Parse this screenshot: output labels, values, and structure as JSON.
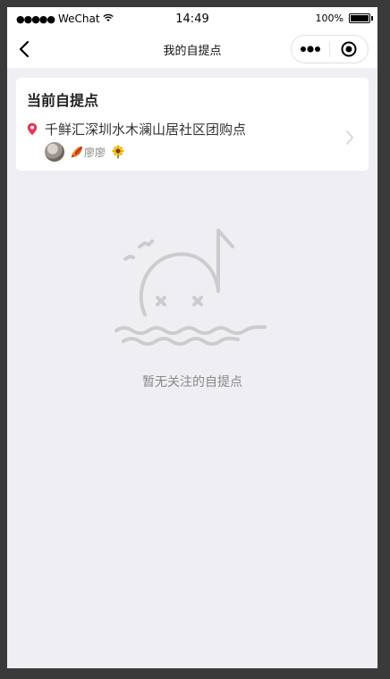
{
  "status_bar": {
    "signal": "●●●●●",
    "carrier": "WeChat",
    "time": "14:49",
    "battery": "100%"
  },
  "nav": {
    "title": "我的自提点"
  },
  "current_pickup": {
    "section_title": "当前自提点",
    "name": "千鲜汇深圳水木澜山居社区团购点",
    "leader_name": "廖廖"
  },
  "empty_state": {
    "message": "暂无关注的自提点"
  },
  "colors": {
    "accent_pin": "#f0325a",
    "illustration": "#cccccc"
  },
  "icons": [
    "back-arrow-icon",
    "more-dots-icon",
    "close-circle-icon",
    "location-pin-icon",
    "chevron-right-icon",
    "leaf-emoji-icon",
    "sunflower-emoji-icon"
  ]
}
